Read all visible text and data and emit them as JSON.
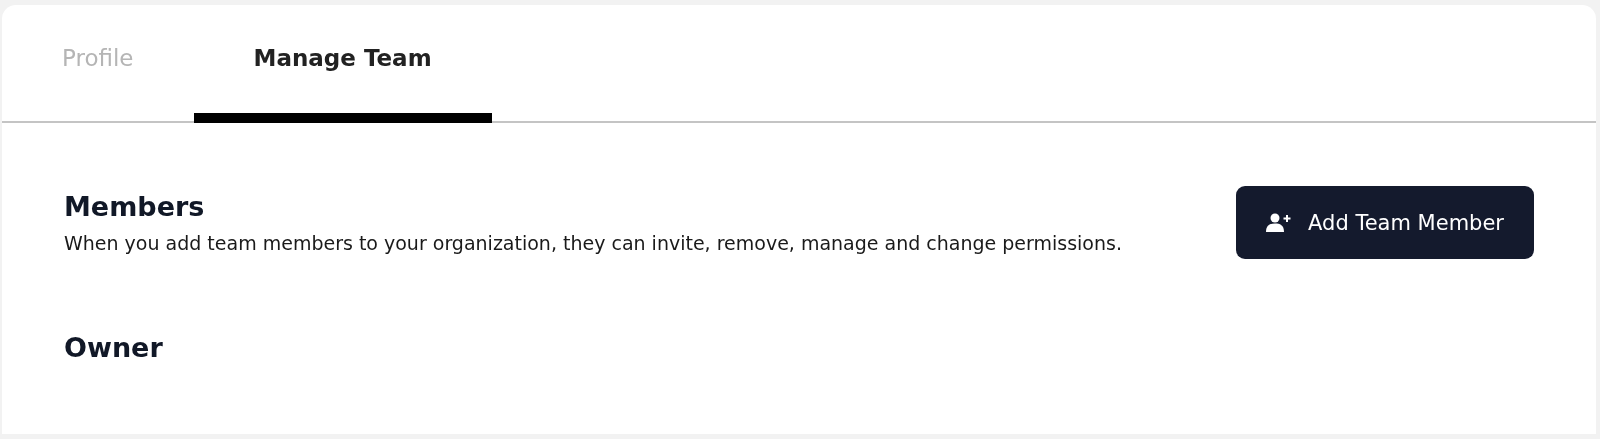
{
  "tabs": [
    {
      "label": "Profile",
      "selected": false
    },
    {
      "label": "Manage Team",
      "selected": true
    }
  ],
  "members": {
    "title": "Members",
    "description": "When you add team members to your organization, they can invite, remove, manage and change permissions.",
    "button": "Add Team Member"
  },
  "owner": {
    "title": "Owner"
  }
}
